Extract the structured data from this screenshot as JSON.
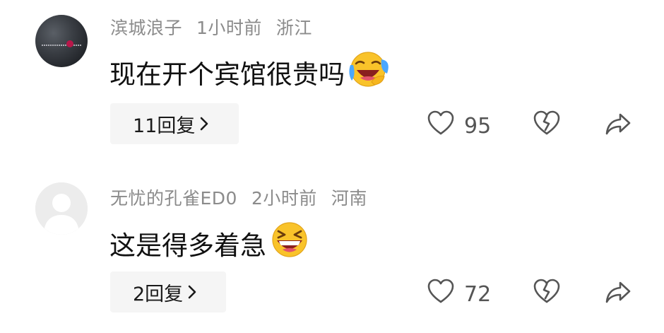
{
  "comments": [
    {
      "username": "滨城浪子",
      "time": "1小时前",
      "location": "浙江",
      "text": "现在开个宾馆很贵吗",
      "emoji_icon": "laughing-crying-emoji",
      "reply_label": "11回复",
      "likes": "95",
      "avatar_style": "dark-photo"
    },
    {
      "username": "无忧的孔雀ED0",
      "time": "2小时前",
      "location": "河南",
      "text": "这是得多着急",
      "emoji_icon": "grinning-squinting-emoji",
      "reply_label": "2回复",
      "likes": "72",
      "avatar_style": "default-gray"
    }
  ],
  "colors": {
    "meta_text": "#8b8b8b",
    "content_text": "#111111",
    "reply_bg": "#f5f5f5",
    "icon_gray": "#555555",
    "emoji_yellow": "#f9c32a",
    "emoji_mouth": "#d9254a"
  }
}
